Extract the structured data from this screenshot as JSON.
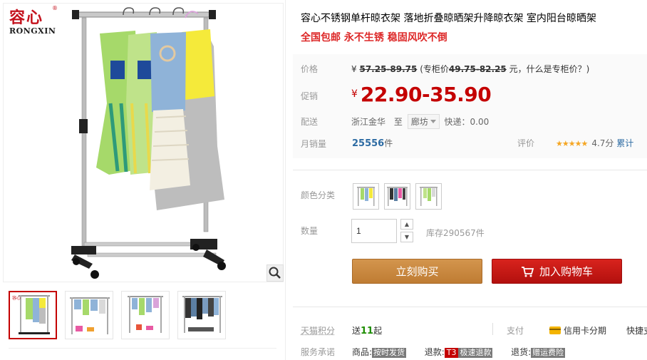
{
  "brand": {
    "name_cn": "容心",
    "name_en": "RONGXIN",
    "registered": "®"
  },
  "product": {
    "title": "容心不锈钢单杆晾衣架 落地折叠晾晒架升降晾衣架 室内阳台晾晒架",
    "subtitle": "全国包邮 永不生锈 稳固风吹不倒"
  },
  "price": {
    "label": "价格",
    "currency": "¥",
    "original": "57.25-89.75",
    "counter_prefix": "(专柜价",
    "counter_price": "49.75-82.25",
    "counter_suffix": "元，什么是专柜价？)"
  },
  "promo": {
    "label": "促销",
    "currency": "¥",
    "value": "22.90-35.90"
  },
  "shipping": {
    "label": "配送",
    "from": "浙江金华",
    "to_word": "至",
    "destination": "廊坊",
    "fee": "快递：0.00"
  },
  "sales": {
    "label": "月销量",
    "count": "25556",
    "unit": "件",
    "rating_label": "评价",
    "stars": "★★★★★",
    "score": "4.7分",
    "more": "累计"
  },
  "options": {
    "color_label": "颜色分类",
    "qty_label": "数量",
    "qty_value": "1",
    "stock": "库存290567件"
  },
  "actions": {
    "buy": "立刻购买",
    "cart": "加入购物车"
  },
  "extra": {
    "points_label": "天猫积分",
    "points_prefix": "送",
    "points_value": "11",
    "points_suffix": "起",
    "pay_label": "支付",
    "credit": "信用卡分期",
    "express": "快捷支",
    "promise_label": "服务承诺",
    "goods_label": "商品:",
    "goods_tag": "按时发货",
    "refund_label": "退款:",
    "refund_tag_prefix": "T3",
    "refund_tag": "极速退款",
    "return_label": "退货:",
    "return_tag": "赠运费险"
  },
  "colors": {
    "accent": "#c40000",
    "buy": "#c8863e",
    "cart": "#c81a16",
    "points": "#1e8d00"
  }
}
